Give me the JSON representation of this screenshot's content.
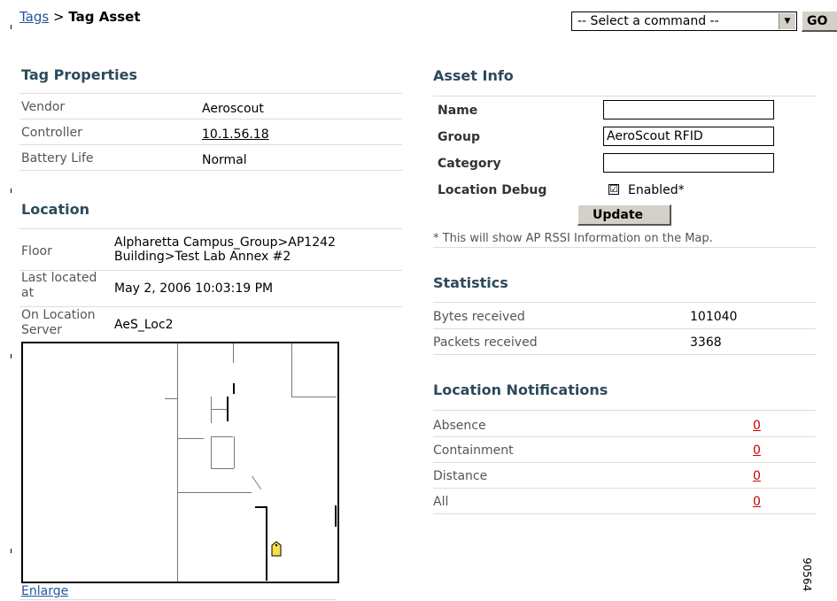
{
  "breadcrumb": {
    "link": "Tags",
    "separator": " > ",
    "current": "Tag Asset"
  },
  "command": {
    "selected": "-- Select a command --",
    "go_label": "GO"
  },
  "tag_properties": {
    "heading": "Tag Properties",
    "rows": [
      {
        "label": "Vendor",
        "value": "Aeroscout"
      },
      {
        "label": "Controller",
        "value": "10.1.56.18"
      },
      {
        "label": "Battery Life",
        "value": "Normal"
      }
    ]
  },
  "location": {
    "heading": "Location",
    "floor_label": "Floor",
    "floor_value_1": "Alpharetta Campus_Group>AP1242",
    "floor_value_2": "Building>Test Lab Annex #2",
    "last_label_1": "Last located",
    "last_label_2": "at",
    "last_value": "May 2, 2006 10:03:19 PM",
    "server_label_1": "On Location",
    "server_label_2": "Server",
    "server_value": "AeS_Loc2",
    "enlarge_label": "Enlarge"
  },
  "asset_info": {
    "heading": "Asset Info",
    "name_label": "Name",
    "name_value": "",
    "group_label": "Group",
    "group_value": "AeroScout RFID",
    "category_label": "Category",
    "category_value": "",
    "debug_label": "Location Debug",
    "enabled_checked": "☑",
    "enabled_label": "Enabled*",
    "update_label": "Update",
    "note": "* This will show AP RSSI Information on the Map."
  },
  "statistics": {
    "heading": "Statistics",
    "rows": [
      {
        "label": "Bytes received",
        "value": "101040"
      },
      {
        "label": "Packets received",
        "value": "3368"
      }
    ]
  },
  "notifications": {
    "heading": "Location Notifications",
    "rows": [
      {
        "label": "Absence",
        "value": "0"
      },
      {
        "label": "Containment",
        "value": "0"
      },
      {
        "label": "Distance",
        "value": "0"
      },
      {
        "label": "All",
        "value": "0"
      }
    ]
  },
  "figure_id": "90564"
}
